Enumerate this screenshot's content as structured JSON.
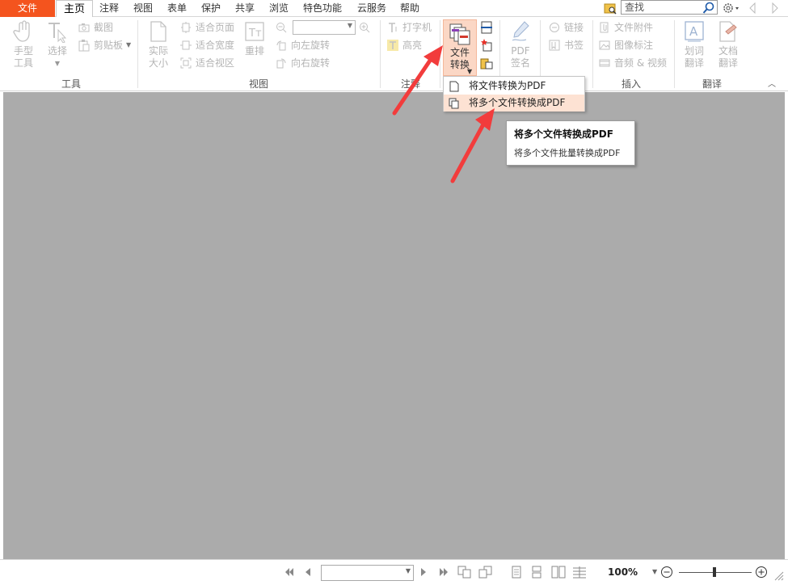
{
  "menubar": {
    "file_label": "文件",
    "tabs": [
      "主页",
      "注释",
      "视图",
      "表单",
      "保护",
      "共享",
      "浏览",
      "特色功能",
      "云服务",
      "帮助"
    ],
    "search_placeholder": "查找"
  },
  "ribbon": {
    "tools": {
      "hand": "手型\n工具",
      "select": "选择",
      "screenshot": "截图",
      "clipboard": "剪贴板",
      "label": "工具"
    },
    "view": {
      "actual_size": "实际\n大小",
      "fit_page": "适合页面",
      "fit_width": "适合宽度",
      "fit_view": "适合视区",
      "reflow": "重排",
      "rotate_left": "向左旋转",
      "rotate_right": "向右旋转",
      "label": "视图"
    },
    "annotate": {
      "typewriter": "打字机",
      "highlight": "高亮",
      "label": "注释"
    },
    "convert": {
      "file_convert": "文件\n转换"
    },
    "sign": {
      "pdf_sign": "PDF\n签名"
    },
    "links": {
      "link": "链接",
      "bookmark": "书签"
    },
    "insert": {
      "attachment": "文件附件",
      "image_annot": "图像标注",
      "audio_video": "音频 & 视频",
      "label": "插入"
    },
    "translate": {
      "word_translate": "划词\n翻译",
      "doc_translate": "文档\n翻译",
      "label": "翻译"
    }
  },
  "dropdown": {
    "items": [
      "将文件转换为PDF",
      "将多个文件转换成PDF"
    ]
  },
  "tooltip": {
    "title": "将多个文件转换成PDF",
    "description": "将多个文件批量转换成PDF"
  },
  "statusbar": {
    "zoom": "100%"
  },
  "colors": {
    "accent": "#f4541e",
    "highlight": "#fde2d3",
    "canvas": "#ababab",
    "arrow": "#f23c3c"
  }
}
